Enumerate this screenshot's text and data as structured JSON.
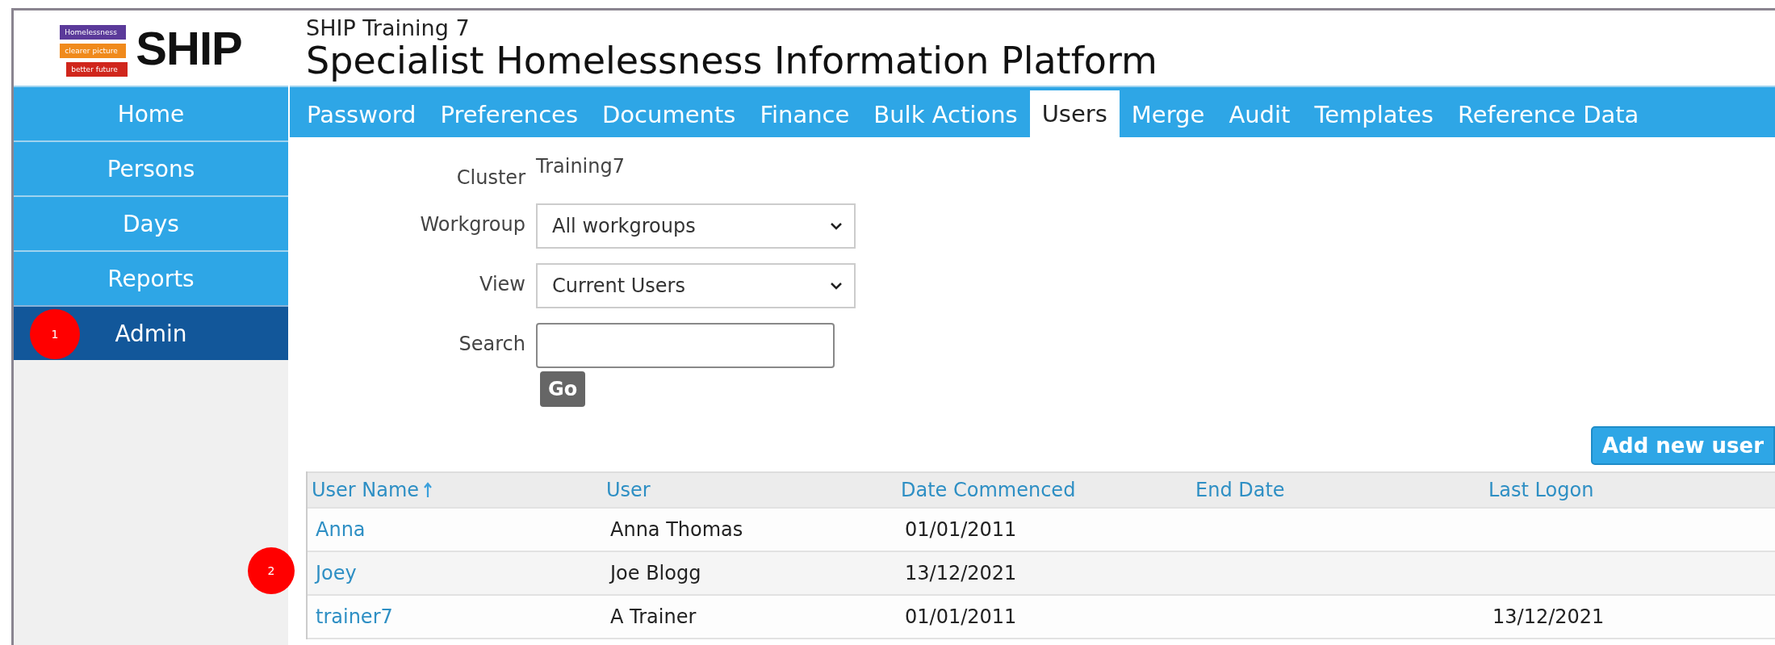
{
  "logo": {
    "ribbons": [
      "Homelessness",
      "clearer picture",
      "better future"
    ],
    "wordmark": "SHIP"
  },
  "header": {
    "subtitle": "SHIP Training 7",
    "title": "Specialist Homelessness Information Platform"
  },
  "sidebar": {
    "items": [
      {
        "label": "Home",
        "selected": false
      },
      {
        "label": "Persons",
        "selected": false
      },
      {
        "label": "Days",
        "selected": false
      },
      {
        "label": "Reports",
        "selected": false
      },
      {
        "label": "Admin",
        "selected": true,
        "marker": "1"
      }
    ]
  },
  "tabs": [
    {
      "label": "Password",
      "selected": false
    },
    {
      "label": "Preferences",
      "selected": false
    },
    {
      "label": "Documents",
      "selected": false
    },
    {
      "label": "Finance",
      "selected": false
    },
    {
      "label": "Bulk Actions",
      "selected": false
    },
    {
      "label": "Users",
      "selected": true
    },
    {
      "label": "Merge",
      "selected": false
    },
    {
      "label": "Audit",
      "selected": false
    },
    {
      "label": "Templates",
      "selected": false
    },
    {
      "label": "Reference Data",
      "selected": false
    }
  ],
  "form": {
    "fields": [
      {
        "kind": "text",
        "label": "Cluster",
        "value": "Training7"
      },
      {
        "kind": "select",
        "label": "Workgroup",
        "value": "All workgroups"
      },
      {
        "kind": "select",
        "label": "View",
        "value": "Current Users"
      },
      {
        "kind": "input",
        "label": "Search"
      }
    ],
    "go_button": "Go"
  },
  "add_button": "Add new user",
  "table": {
    "columns": [
      {
        "label": "User Name",
        "sorted": true
      },
      {
        "label": "User",
        "sorted": false
      },
      {
        "label": "Date Commenced",
        "sorted": false
      },
      {
        "label": "End Date",
        "sorted": false
      },
      {
        "label": "Last Logon",
        "sorted": false
      }
    ],
    "rows": [
      {
        "cells": [
          "Anna",
          "Anna Thomas",
          "01/01/2011",
          "",
          ""
        ]
      },
      {
        "cells": [
          "Joey",
          "Joe Blogg",
          "13/12/2021",
          "",
          ""
        ],
        "marker": "2"
      },
      {
        "cells": [
          "trainer7",
          "A Trainer",
          "01/01/2011",
          "",
          "13/12/2021"
        ]
      }
    ]
  }
}
